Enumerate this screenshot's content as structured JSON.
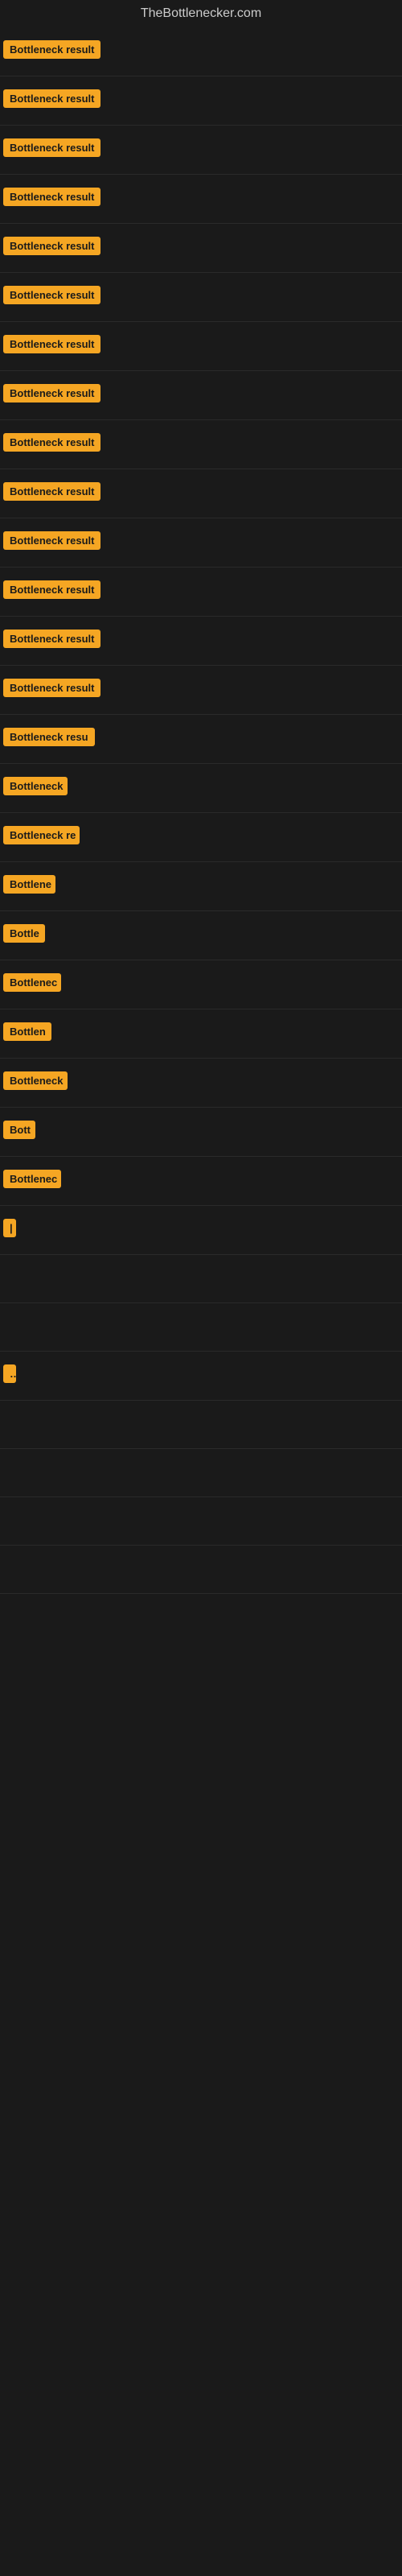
{
  "site": {
    "title": "TheBottlenecker.com"
  },
  "rows": [
    {
      "id": 1,
      "label": "Bottleneck result",
      "width": 130
    },
    {
      "id": 2,
      "label": "Bottleneck result",
      "width": 130
    },
    {
      "id": 3,
      "label": "Bottleneck result",
      "width": 130
    },
    {
      "id": 4,
      "label": "Bottleneck result",
      "width": 130
    },
    {
      "id": 5,
      "label": "Bottleneck result",
      "width": 130
    },
    {
      "id": 6,
      "label": "Bottleneck result",
      "width": 130
    },
    {
      "id": 7,
      "label": "Bottleneck result",
      "width": 130
    },
    {
      "id": 8,
      "label": "Bottleneck result",
      "width": 130
    },
    {
      "id": 9,
      "label": "Bottleneck result",
      "width": 130
    },
    {
      "id": 10,
      "label": "Bottleneck result",
      "width": 130
    },
    {
      "id": 11,
      "label": "Bottleneck result",
      "width": 130
    },
    {
      "id": 12,
      "label": "Bottleneck result",
      "width": 130
    },
    {
      "id": 13,
      "label": "Bottleneck result",
      "width": 130
    },
    {
      "id": 14,
      "label": "Bottleneck result",
      "width": 130
    },
    {
      "id": 15,
      "label": "Bottleneck resu",
      "width": 115
    },
    {
      "id": 16,
      "label": "Bottleneck",
      "width": 80
    },
    {
      "id": 17,
      "label": "Bottleneck re",
      "width": 95
    },
    {
      "id": 18,
      "label": "Bottlene",
      "width": 65
    },
    {
      "id": 19,
      "label": "Bottle",
      "width": 52
    },
    {
      "id": 20,
      "label": "Bottlenec",
      "width": 72
    },
    {
      "id": 21,
      "label": "Bottlen",
      "width": 60
    },
    {
      "id": 22,
      "label": "Bottleneck",
      "width": 80
    },
    {
      "id": 23,
      "label": "Bott",
      "width": 40
    },
    {
      "id": 24,
      "label": "Bottlenec",
      "width": 72
    },
    {
      "id": 25,
      "label": "|",
      "width": 8
    },
    {
      "id": 26,
      "label": "",
      "width": 0
    },
    {
      "id": 27,
      "label": "",
      "width": 0
    },
    {
      "id": 28,
      "label": "…",
      "width": 12
    },
    {
      "id": 29,
      "label": "",
      "width": 0
    },
    {
      "id": 30,
      "label": "",
      "width": 0
    },
    {
      "id": 31,
      "label": "",
      "width": 0
    },
    {
      "id": 32,
      "label": "",
      "width": 0
    }
  ]
}
